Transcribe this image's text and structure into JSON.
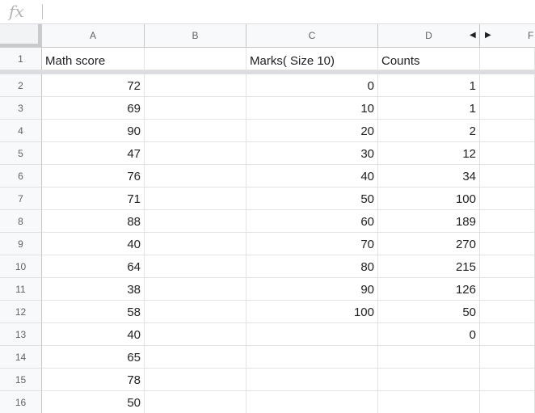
{
  "formula_bar": {
    "fx_label": "fx",
    "value": ""
  },
  "column_headers": [
    "A",
    "B",
    "C",
    "D",
    "F"
  ],
  "row_headers": [
    "1",
    "2",
    "3",
    "4",
    "5",
    "6",
    "7",
    "8",
    "9",
    "10",
    "11",
    "12",
    "13",
    "14",
    "15",
    "16"
  ],
  "header_row": {
    "A": "Math score",
    "B": "",
    "C": "Marks( Size 10)",
    "D": "Counts"
  },
  "math_scores": [
    "72",
    "69",
    "90",
    "47",
    "76",
    "71",
    "88",
    "40",
    "64",
    "38",
    "58",
    "40",
    "65",
    "78",
    "50"
  ],
  "marks": [
    "0",
    "10",
    "20",
    "30",
    "40",
    "50",
    "60",
    "70",
    "80",
    "90",
    "100",
    "",
    "",
    "",
    ""
  ],
  "counts": [
    "1",
    "1",
    "2",
    "12",
    "34",
    "100",
    "189",
    "270",
    "215",
    "126",
    "50",
    "0",
    "",
    "",
    ""
  ],
  "icons": {
    "col_collapse_left": "triangle-left-icon",
    "col_expand_right": "triangle-right-icon"
  }
}
